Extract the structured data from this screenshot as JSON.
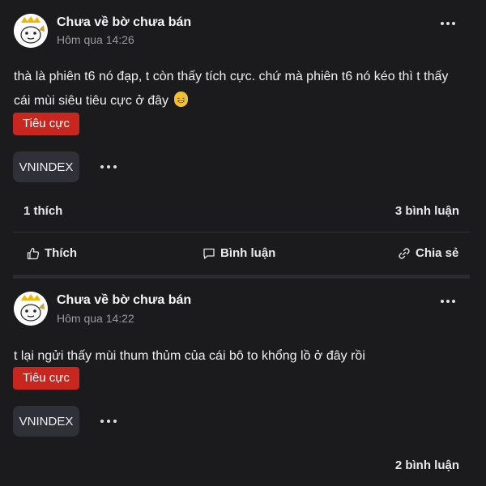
{
  "posts": [
    {
      "author": "Chưa về bờ chưa bán",
      "time": "Hôm qua 14:26",
      "content": "thà là phiên t6 nó đạp, t còn thấy tích cực. chứ mà phiên t6 nó kéo thì t thấy cái mùi siêu tiêu cực ở đây",
      "content_emoji_icon": "grinning-sweat-emoji-icon",
      "sentiment": "Tiêu cực",
      "ticker": "VNINDEX",
      "likes": "1 thích",
      "comments": "3 bình luận"
    },
    {
      "author": "Chưa về bờ chưa bán",
      "time": "Hôm qua 14:22",
      "content": "t lại ngửi thấy mùi thum thủm của cái bô to khổng lồ ở đây rồi",
      "sentiment": "Tiêu cực",
      "ticker": "VNINDEX",
      "comments": "2 bình luận"
    }
  ],
  "actions": {
    "like": "Thích",
    "comment": "Bình luận",
    "share": "Chia sẻ"
  },
  "colors": {
    "background": "#1b1b1d",
    "sentiment_negative": "#c8261f",
    "ticker_bg": "#2f3038",
    "muted_text": "#9a9aa0"
  }
}
